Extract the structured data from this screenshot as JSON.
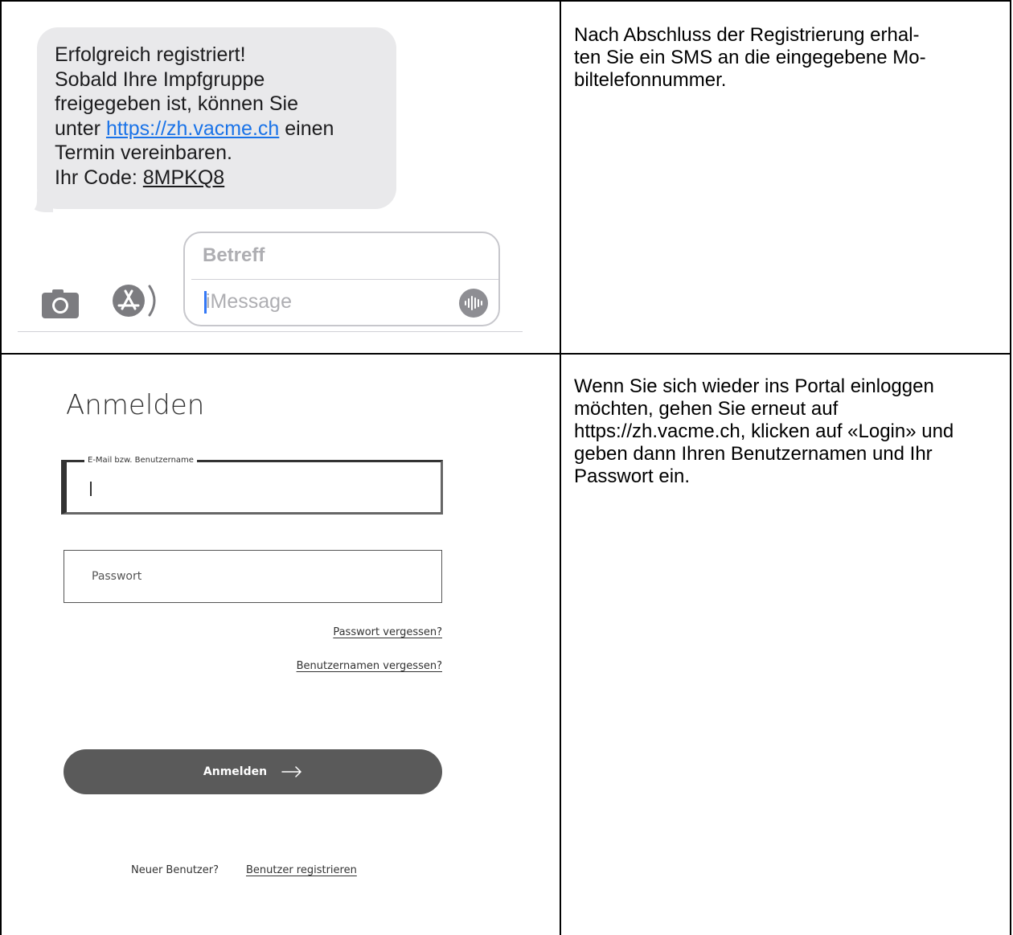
{
  "sms": {
    "line1": "Erfolgreich registriert!",
    "line2": "Sobald Ihre Impfgruppe",
    "line3": "freigegeben ist, können Sie",
    "line4_prefix": "unter ",
    "link": "https://zh.vacme.ch",
    "line4_suffix": " einen",
    "line5": "Termin vereinbaren.",
    "code_prefix": "Ihr Code: ",
    "code": "8MPKQ8"
  },
  "compose": {
    "subject_placeholder": "Betreff",
    "message_placeholder": "iMessage",
    "icons": [
      "camera-icon",
      "appstore-icon",
      "audio-waveform-icon"
    ]
  },
  "step1": {
    "description": "Nach Abschluss der Registrierung erhal-ten Sie ein SMS an die eingegebene Mo-biltelefonnummer."
  },
  "login": {
    "title": "Anmelden",
    "email_label": "E-Mail bzw. Benutzername",
    "password_placeholder": "Passwort",
    "forgot_password": "Passwort vergessen?",
    "forgot_username": "Benutzernamen vergessen?",
    "submit_label": "Anmelden",
    "new_user_text": "Neuer Benutzer?",
    "register_link": "Benutzer registrieren"
  },
  "step2": {
    "description": "Wenn Sie sich wieder ins Portal einloggen möchten, gehen Sie erneut auf https://zh.vacme.ch, klicken auf «Login» und geben dann Ihren Benutzernamen und Ihr Passwort ein."
  }
}
